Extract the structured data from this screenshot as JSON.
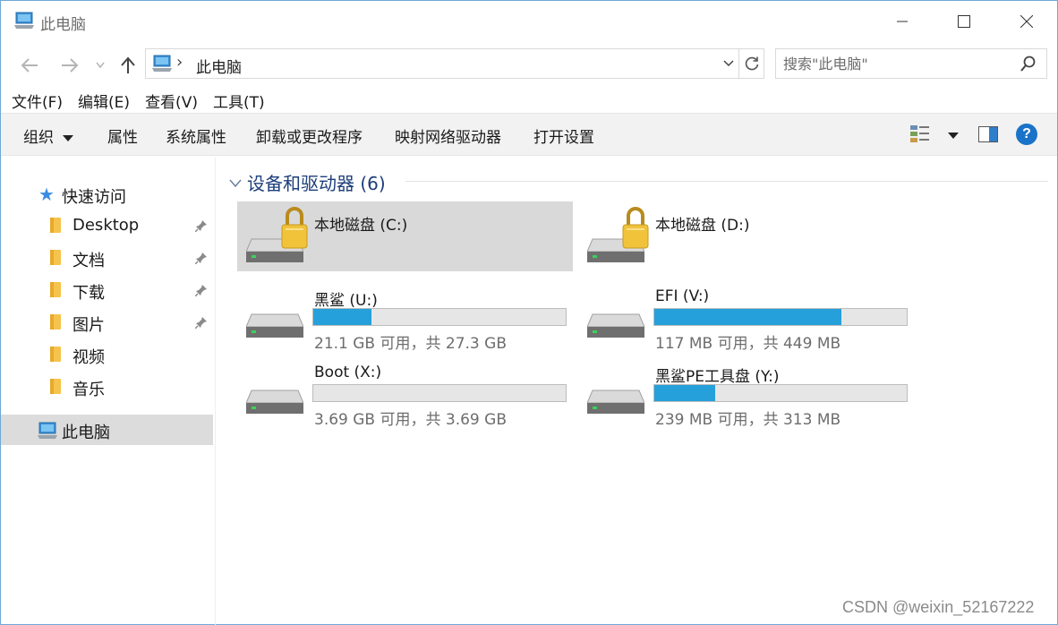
{
  "window": {
    "title": "此电脑",
    "accent": "#6fa8d6"
  },
  "address": {
    "crumb": "此电脑",
    "separator": "›"
  },
  "search": {
    "placeholder": "搜索\"此电脑\""
  },
  "menu": {
    "file": "文件(F)",
    "edit": "编辑(E)",
    "view": "查看(V)",
    "tools": "工具(T)"
  },
  "commands": {
    "organize": "组织",
    "properties": "属性",
    "system_properties": "系统属性",
    "uninstall": "卸载或更改程序",
    "map_drive": "映射网络驱动器",
    "open_settings": "打开设置",
    "help": "?"
  },
  "nav": {
    "quick_access": "快速访问",
    "items": [
      {
        "label": "Desktop",
        "pinned": true
      },
      {
        "label": "文档",
        "pinned": true
      },
      {
        "label": "下载",
        "pinned": true
      },
      {
        "label": "图片",
        "pinned": true
      },
      {
        "label": "视频",
        "pinned": false
      },
      {
        "label": "音乐",
        "pinned": false
      }
    ],
    "this_pc": "此电脑"
  },
  "group": {
    "title": "设备和驱动器 (6)"
  },
  "drives": [
    {
      "name": "本地磁盘 (C:)",
      "locked": true,
      "selected": true,
      "free": "",
      "used_fraction": null
    },
    {
      "name": "本地磁盘 (D:)",
      "locked": true,
      "selected": false,
      "free": "",
      "used_fraction": null
    },
    {
      "name": "黑鲨 (U:)",
      "locked": false,
      "selected": false,
      "free": "21.1 GB 可用，共 27.3 GB",
      "used_fraction": 0.23
    },
    {
      "name": "EFI (V:)",
      "locked": false,
      "selected": false,
      "free": "117 MB 可用，共 449 MB",
      "used_fraction": 0.74
    },
    {
      "name": "Boot (X:)",
      "locked": false,
      "selected": false,
      "free": "3.69 GB 可用，共 3.69 GB",
      "used_fraction": 0.0
    },
    {
      "name": "黑鲨PE工具盘 (Y:)",
      "locked": false,
      "selected": false,
      "free": "239 MB 可用，共 313 MB",
      "used_fraction": 0.24
    }
  ],
  "colors": {
    "bar_fill": "#26a0da",
    "group_title": "#1e3e7a",
    "selection": "#d9d9d9"
  },
  "watermark": "CSDN @weixin_52167222"
}
